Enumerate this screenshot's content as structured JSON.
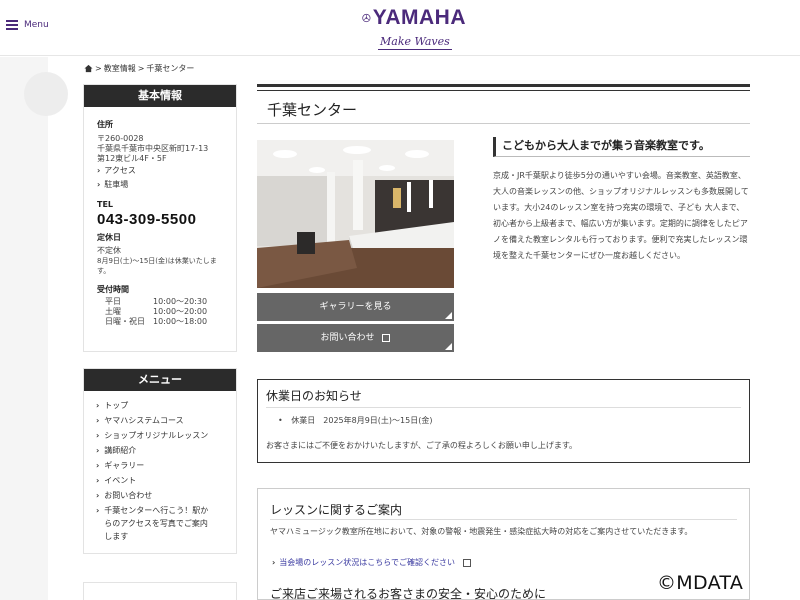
{
  "header": {
    "menu_label": "Menu",
    "logo_word": "YAMAHA",
    "logo_tagline": "Make Waves"
  },
  "breadcrumb": {
    "sep1": ">",
    "item1": "教室情報",
    "sep2": ">",
    "item2": "千葉センター"
  },
  "info": {
    "heading": "基本情報",
    "address_label": "住所",
    "postal": "〒260-0028",
    "address1": "千葉県千葉市中央区新町17-13",
    "address2": "第12東ビル4F・5F",
    "access_link": "アクセス",
    "parking_link": "駐車場",
    "tel_label": "TEL",
    "tel": "043-309-5500",
    "closed_label": "定休日",
    "closed_value": "不定休",
    "closed_note1": "8月9日(土)～15日(金)は休業いたしま",
    "closed_note2": "す。",
    "hours_label": "受付時間",
    "hours": [
      {
        "day": "平日",
        "time": "10:00～20:30"
      },
      {
        "day": "土曜",
        "time": "10:00～20:00"
      },
      {
        "day": "日曜・祝日",
        "time": "10:00～18:00"
      }
    ]
  },
  "side_menu": {
    "heading": "メニュー",
    "items": [
      "トップ",
      "ヤマハシステムコース",
      "ショップオリジナルレッスン",
      "講師紹介",
      "ギャラリー",
      "イベント",
      "お問い合わせ"
    ],
    "last_item_lines": [
      "千葉センターへ行こう！駅か",
      "らのアクセスを写真でご案内",
      "します"
    ]
  },
  "main": {
    "page_title": "千葉センター",
    "gallery_button": "ギャラリーを見る",
    "contact_button": "お問い合わせ",
    "catch": "こどもから大人までが集う音楽教室です。",
    "intro": "京成・JR千葉駅より徒歩5分の通いやすい会場。音楽教室、英語教室、大人の音楽レッスンの他、ショップオリジナルレッスンも多数展開しています。大小24のレッスン室を持つ充実の環境で、子ども 大人まで、初心者から上級者まで、幅広い方が集います。定期的に調律をしたピアノを備えた教室レンタルも行っております。便利で充実したレッスン環境を整えた千葉センターにぜひ一度お越しください。"
  },
  "notice": {
    "title": "休業日のお知らせ",
    "bullet": "•",
    "item": "休業日　2025年8月9日(土)～15日(金)",
    "text": "お客さまにはご不便をおかけいたしますが、ご了承の程よろしくお願い申し上げます。"
  },
  "lesson": {
    "title": "レッスンに関するご案内",
    "text": "ヤマハミュージック教室所在地において、対象の警報・地震発生・感染症拡大時の対応をご案内させていただきます。",
    "link": "当会場のレッスン状況はこちらでご確認ください",
    "title2": "ご来店ご来場されるお客さまの安全・安心のために"
  },
  "watermark": "©MDATA",
  "colors": {
    "brand": "#4b2a7b",
    "sidebar_head": "#2b2b2b",
    "button_gray": "#666666"
  }
}
